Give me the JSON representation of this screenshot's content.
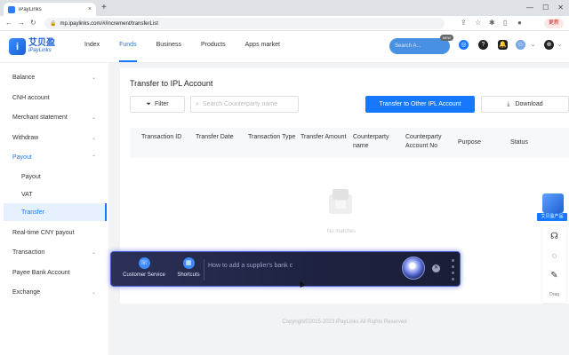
{
  "browser": {
    "tab_title": "iPayLinks",
    "tab_close": "×",
    "new_tab": "+",
    "url": "mp.ipaylinks.com/#/increment/transferList",
    "update_label": "更新"
  },
  "header": {
    "logo_cn": "艾贝盈",
    "logo_en": "iPayLinks",
    "nav": [
      {
        "label": "Index"
      },
      {
        "label": "Funds"
      },
      {
        "label": "Business"
      },
      {
        "label": "Products"
      },
      {
        "label": "Apps market"
      }
    ],
    "search_placeholder": "Search A...",
    "search_badge": "NEW"
  },
  "sidebar": {
    "items": [
      {
        "label": "Balance"
      },
      {
        "label": "CNH account"
      },
      {
        "label": "Merchant statement"
      },
      {
        "label": "Withdraw"
      },
      {
        "label": "Payout"
      },
      {
        "label": "Payout"
      },
      {
        "label": "VAT"
      },
      {
        "label": "Transfer"
      },
      {
        "label": "Real-time CNY payout"
      },
      {
        "label": "Transaction"
      },
      {
        "label": "Payee Bank Account"
      },
      {
        "label": "Exchange"
      }
    ]
  },
  "main": {
    "title": "Transfer to IPL Account",
    "filter_label": "Filter",
    "search_placeholder": "Search Counterparty name",
    "primary_button": "Transfer to Other IPL Account",
    "download_label": "Download",
    "columns": [
      "Transaction ID",
      "Transfer Date",
      "Transaction Type",
      "Transfer Amount",
      "Counterparty name",
      "Counterparty Account No",
      "Purpose",
      "Status"
    ],
    "empty_text": "No matches"
  },
  "footer": {
    "copyright": "Copyright©2015-2023 iPayLinks All Rights Reserved"
  },
  "assistant": {
    "customer_service": "Customer Service",
    "shortcuts": "Shortcuts",
    "input_placeholder": "How to add a supplier's bank c"
  },
  "right_widgets": {
    "promo_label": "艾贝盈产品",
    "bottom_label": "Drag"
  },
  "colors": {
    "accent": "#1677ff",
    "assistant_bg": "#1e2240"
  }
}
